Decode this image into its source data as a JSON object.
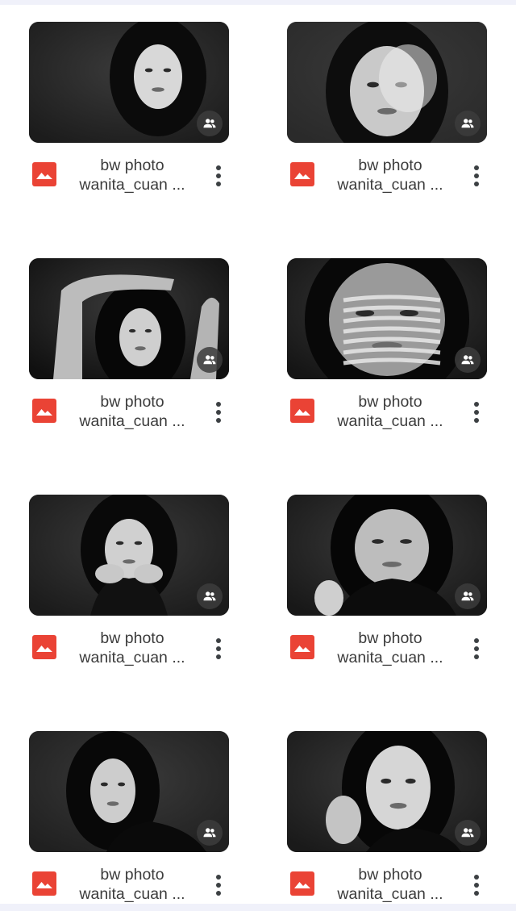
{
  "files": [
    {
      "line1": "bw photo",
      "line2": "wanita_cuan ...",
      "variant": "hair-side"
    },
    {
      "line1": "bw photo",
      "line2": "wanita_cuan ...",
      "variant": "sunlit"
    },
    {
      "line1": "bw photo",
      "line2": "wanita_cuan ...",
      "variant": "arms-up"
    },
    {
      "line1": "bw photo",
      "line2": "wanita_cuan ...",
      "variant": "stripes"
    },
    {
      "line1": "bw photo",
      "line2": "wanita_cuan ...",
      "variant": "hands-chin"
    },
    {
      "line1": "bw photo",
      "line2": "wanita_cuan ...",
      "variant": "sweater-hair"
    },
    {
      "line1": "bw photo",
      "line2": "wanita_cuan ...",
      "variant": "profile"
    },
    {
      "line1": "bw photo",
      "line2": "wanita_cuan ...",
      "variant": "hand-hair"
    }
  ],
  "icons": {
    "file_type": "image-file-icon",
    "shared": "shared-people-icon",
    "more": "more-vert-icon"
  },
  "colors": {
    "file_type_red": "#ea4335",
    "background": "#f0f1fa",
    "text": "#3c3c3c"
  }
}
